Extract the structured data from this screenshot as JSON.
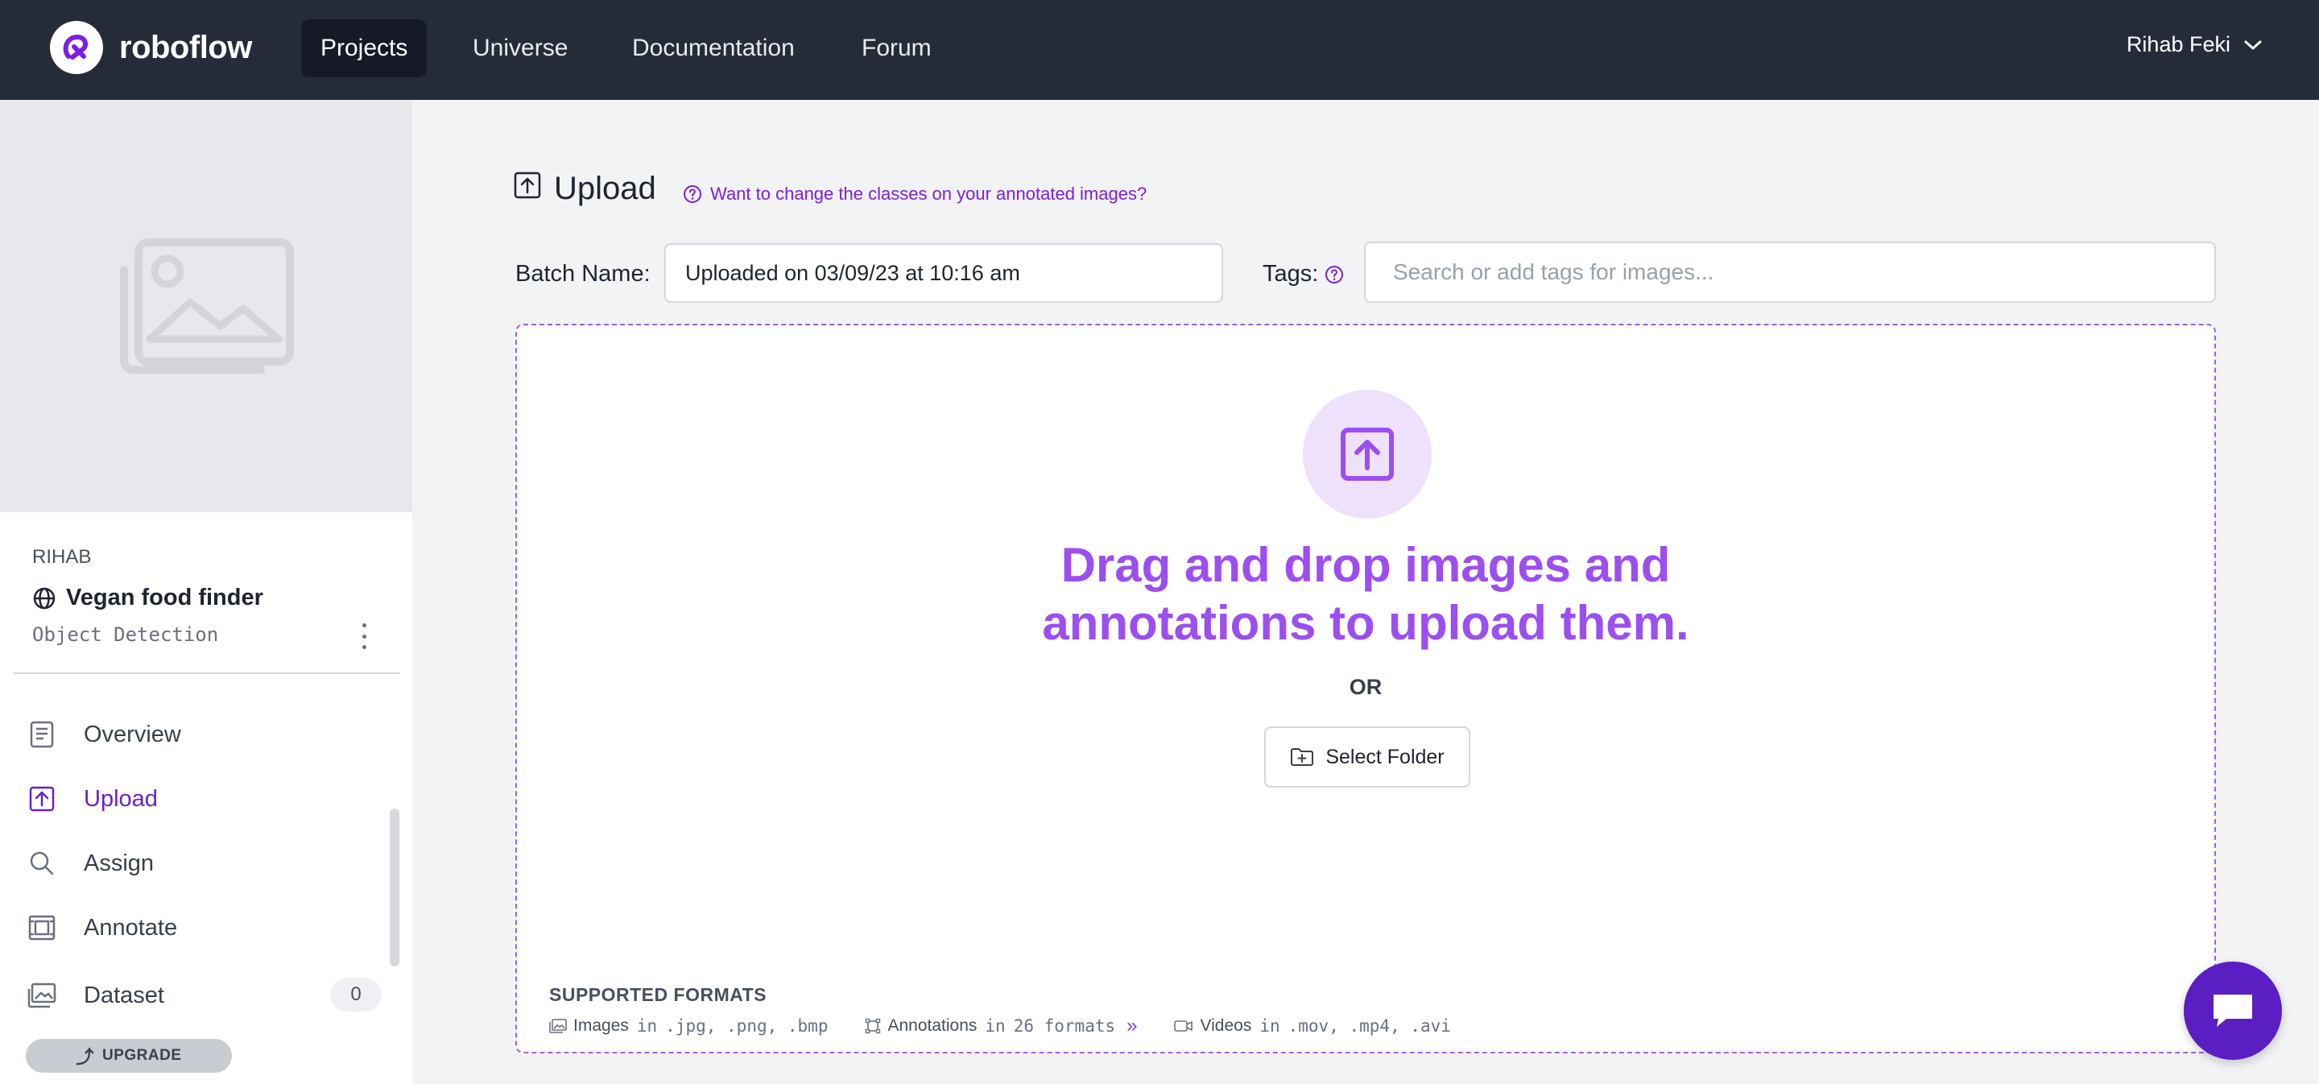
{
  "brand": {
    "name": "roboflow"
  },
  "nav": {
    "items": [
      {
        "label": "Projects"
      },
      {
        "label": "Universe"
      },
      {
        "label": "Documentation"
      },
      {
        "label": "Forum"
      }
    ],
    "user": "Rihab Feki"
  },
  "sidebar": {
    "workspace": "RIHAB",
    "project_name": "Vegan food finder",
    "project_type": "Object Detection",
    "menu": [
      {
        "label": "Overview"
      },
      {
        "label": "Upload"
      },
      {
        "label": "Assign"
      },
      {
        "label": "Annotate"
      },
      {
        "label": "Dataset",
        "count": "0"
      }
    ],
    "upgrade": "UPGRADE"
  },
  "main": {
    "title": "Upload",
    "help_link": "Want to change the classes on your annotated images?",
    "batch_label": "Batch Name:",
    "batch_value": "Uploaded on 03/09/23 at 10:16 am",
    "tags_label": "Tags:",
    "tags_placeholder": "Search or add tags for images...",
    "dropzone": {
      "title_line1": "Drag and drop images and",
      "title_line2": "annotations to upload them.",
      "or": "OR",
      "select_folder": "Select Folder",
      "supported_label": "SUPPORTED FORMATS",
      "images_label": "Images",
      "images_in": "in",
      "images_formats": ".jpg, .png, .bmp",
      "annotations_label": "Annotations",
      "annotations_in": "in",
      "annotations_formats": "26 formats",
      "annotations_more": "»",
      "videos_label": "Videos",
      "videos_in": "in",
      "videos_formats": ".mov, .mp4, .avi"
    }
  },
  "colors": {
    "nav_bg": "#262b3a",
    "accent": "#9c4ff0",
    "accent_dark": "#6b1fd0",
    "chat_button": "#5b1ec2"
  }
}
